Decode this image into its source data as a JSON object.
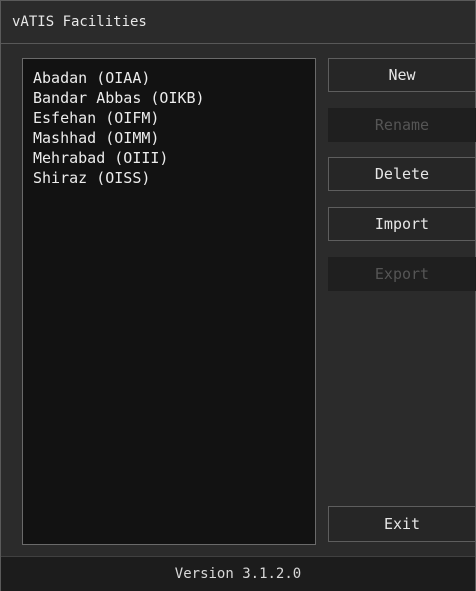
{
  "window": {
    "title": "vATIS Facilities"
  },
  "facilities": {
    "items": [
      {
        "label": "Abadan (OIAA)"
      },
      {
        "label": "Bandar Abbas (OIKB)"
      },
      {
        "label": "Esfehan (OIFM)"
      },
      {
        "label": "Mashhad (OIMM)"
      },
      {
        "label": "Mehrabad (OIII)"
      },
      {
        "label": "Shiraz (OISS)"
      }
    ]
  },
  "buttons": {
    "new_label": "New",
    "rename_label": "Rename",
    "delete_label": "Delete",
    "import_label": "Import",
    "export_label": "Export",
    "exit_label": "Exit"
  },
  "status": {
    "version": "Version 3.1.2.0"
  },
  "colors": {
    "background": "#2b2b2b",
    "list_background": "#121212",
    "text": "#e6e6e6",
    "disabled_text": "#555555"
  }
}
